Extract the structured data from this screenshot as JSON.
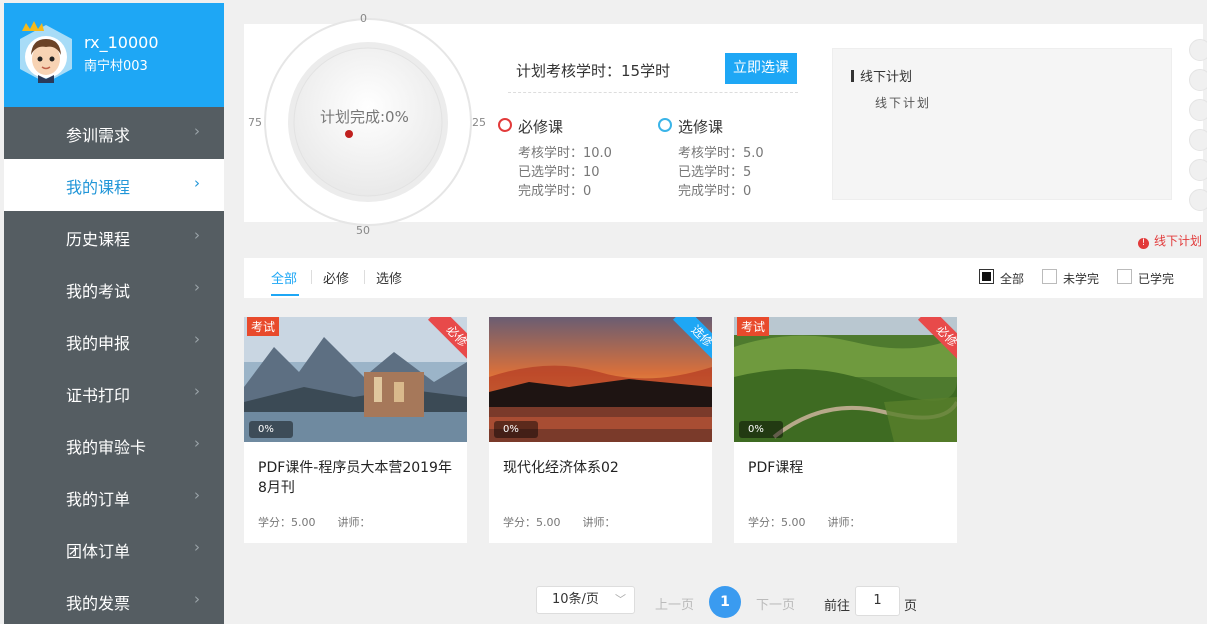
{
  "user": {
    "name": "rx_10000",
    "org": "南宁村003"
  },
  "sidebar": {
    "items": [
      {
        "label": "参训需求",
        "active": false
      },
      {
        "label": "我的课程",
        "active": true
      },
      {
        "label": "历史课程",
        "active": false
      },
      {
        "label": "我的考试",
        "active": false
      },
      {
        "label": "我的申报",
        "active": false
      },
      {
        "label": "证书打印",
        "active": false
      },
      {
        "label": "我的审验卡",
        "active": false
      },
      {
        "label": "我的订单",
        "active": false
      },
      {
        "label": "团体订单",
        "active": false
      },
      {
        "label": "我的发票",
        "active": false
      }
    ]
  },
  "gauge": {
    "label": "计划完成:0%",
    "ticks": {
      "top": "0",
      "right": "25",
      "bottom": "50",
      "left": "75"
    },
    "percent": 0
  },
  "plan": {
    "hours_text": "计划考核学时：15学时",
    "select_button": "立即选课",
    "required": {
      "title": "必修课",
      "assess": "考核学时：10.0",
      "selected": "已选学时：10",
      "done": "完成学时：0",
      "color": "#e23a3a"
    },
    "elective": {
      "title": "选修课",
      "assess": "考核学时：5.0",
      "selected": "已选学时：5",
      "done": "完成学时：0",
      "color": "#3ab4e8"
    }
  },
  "offline": {
    "title": "线下计划",
    "subtitle": "线下计划",
    "link": "线下计划"
  },
  "filters": {
    "tabs": [
      "全部",
      "必修",
      "选修"
    ],
    "status": [
      {
        "label": "全部",
        "checked": true
      },
      {
        "label": "未学完",
        "checked": false
      },
      {
        "label": "已学完",
        "checked": false
      }
    ]
  },
  "courses": [
    {
      "title": "PDF课件-程序员大本营2019年8月刊",
      "exam_tag": "考试",
      "type_tag": "必修",
      "type_color": "#e84a4a",
      "progress": "0%",
      "credit": "学分：5.00",
      "teacher": "讲师："
    },
    {
      "title": "现代化经济体系02",
      "exam_tag": "",
      "type_tag": "选修",
      "type_color": "#1ea7f5",
      "progress": "0%",
      "credit": "学分：5.00",
      "teacher": "讲师："
    },
    {
      "title": "PDF课程",
      "exam_tag": "考试",
      "type_tag": "必修",
      "type_color": "#e84a4a",
      "progress": "0%",
      "credit": "学分：5.00",
      "teacher": "讲师："
    }
  ],
  "pagination": {
    "page_size": "10条/页",
    "prev": "上一页",
    "current": "1",
    "next": "下一页",
    "goto_prefix": "前往",
    "goto_value": "1",
    "goto_suffix": "页"
  }
}
